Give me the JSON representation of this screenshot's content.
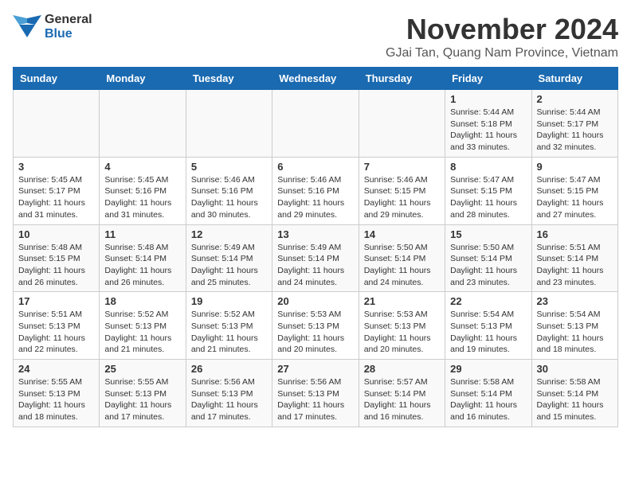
{
  "logo": {
    "general": "General",
    "blue": "Blue"
  },
  "title": "November 2024",
  "location": "GJai Tan, Quang Nam Province, Vietnam",
  "headers": [
    "Sunday",
    "Monday",
    "Tuesday",
    "Wednesday",
    "Thursday",
    "Friday",
    "Saturday"
  ],
  "weeks": [
    [
      {
        "day": "",
        "info": ""
      },
      {
        "day": "",
        "info": ""
      },
      {
        "day": "",
        "info": ""
      },
      {
        "day": "",
        "info": ""
      },
      {
        "day": "",
        "info": ""
      },
      {
        "day": "1",
        "info": "Sunrise: 5:44 AM\nSunset: 5:18 PM\nDaylight: 11 hours\nand 33 minutes."
      },
      {
        "day": "2",
        "info": "Sunrise: 5:44 AM\nSunset: 5:17 PM\nDaylight: 11 hours\nand 32 minutes."
      }
    ],
    [
      {
        "day": "3",
        "info": "Sunrise: 5:45 AM\nSunset: 5:17 PM\nDaylight: 11 hours\nand 31 minutes."
      },
      {
        "day": "4",
        "info": "Sunrise: 5:45 AM\nSunset: 5:16 PM\nDaylight: 11 hours\nand 31 minutes."
      },
      {
        "day": "5",
        "info": "Sunrise: 5:46 AM\nSunset: 5:16 PM\nDaylight: 11 hours\nand 30 minutes."
      },
      {
        "day": "6",
        "info": "Sunrise: 5:46 AM\nSunset: 5:16 PM\nDaylight: 11 hours\nand 29 minutes."
      },
      {
        "day": "7",
        "info": "Sunrise: 5:46 AM\nSunset: 5:15 PM\nDaylight: 11 hours\nand 29 minutes."
      },
      {
        "day": "8",
        "info": "Sunrise: 5:47 AM\nSunset: 5:15 PM\nDaylight: 11 hours\nand 28 minutes."
      },
      {
        "day": "9",
        "info": "Sunrise: 5:47 AM\nSunset: 5:15 PM\nDaylight: 11 hours\nand 27 minutes."
      }
    ],
    [
      {
        "day": "10",
        "info": "Sunrise: 5:48 AM\nSunset: 5:15 PM\nDaylight: 11 hours\nand 26 minutes."
      },
      {
        "day": "11",
        "info": "Sunrise: 5:48 AM\nSunset: 5:14 PM\nDaylight: 11 hours\nand 26 minutes."
      },
      {
        "day": "12",
        "info": "Sunrise: 5:49 AM\nSunset: 5:14 PM\nDaylight: 11 hours\nand 25 minutes."
      },
      {
        "day": "13",
        "info": "Sunrise: 5:49 AM\nSunset: 5:14 PM\nDaylight: 11 hours\nand 24 minutes."
      },
      {
        "day": "14",
        "info": "Sunrise: 5:50 AM\nSunset: 5:14 PM\nDaylight: 11 hours\nand 24 minutes."
      },
      {
        "day": "15",
        "info": "Sunrise: 5:50 AM\nSunset: 5:14 PM\nDaylight: 11 hours\nand 23 minutes."
      },
      {
        "day": "16",
        "info": "Sunrise: 5:51 AM\nSunset: 5:14 PM\nDaylight: 11 hours\nand 23 minutes."
      }
    ],
    [
      {
        "day": "17",
        "info": "Sunrise: 5:51 AM\nSunset: 5:13 PM\nDaylight: 11 hours\nand 22 minutes."
      },
      {
        "day": "18",
        "info": "Sunrise: 5:52 AM\nSunset: 5:13 PM\nDaylight: 11 hours\nand 21 minutes."
      },
      {
        "day": "19",
        "info": "Sunrise: 5:52 AM\nSunset: 5:13 PM\nDaylight: 11 hours\nand 21 minutes."
      },
      {
        "day": "20",
        "info": "Sunrise: 5:53 AM\nSunset: 5:13 PM\nDaylight: 11 hours\nand 20 minutes."
      },
      {
        "day": "21",
        "info": "Sunrise: 5:53 AM\nSunset: 5:13 PM\nDaylight: 11 hours\nand 20 minutes."
      },
      {
        "day": "22",
        "info": "Sunrise: 5:54 AM\nSunset: 5:13 PM\nDaylight: 11 hours\nand 19 minutes."
      },
      {
        "day": "23",
        "info": "Sunrise: 5:54 AM\nSunset: 5:13 PM\nDaylight: 11 hours\nand 18 minutes."
      }
    ],
    [
      {
        "day": "24",
        "info": "Sunrise: 5:55 AM\nSunset: 5:13 PM\nDaylight: 11 hours\nand 18 minutes."
      },
      {
        "day": "25",
        "info": "Sunrise: 5:55 AM\nSunset: 5:13 PM\nDaylight: 11 hours\nand 17 minutes."
      },
      {
        "day": "26",
        "info": "Sunrise: 5:56 AM\nSunset: 5:13 PM\nDaylight: 11 hours\nand 17 minutes."
      },
      {
        "day": "27",
        "info": "Sunrise: 5:56 AM\nSunset: 5:13 PM\nDaylight: 11 hours\nand 17 minutes."
      },
      {
        "day": "28",
        "info": "Sunrise: 5:57 AM\nSunset: 5:14 PM\nDaylight: 11 hours\nand 16 minutes."
      },
      {
        "day": "29",
        "info": "Sunrise: 5:58 AM\nSunset: 5:14 PM\nDaylight: 11 hours\nand 16 minutes."
      },
      {
        "day": "30",
        "info": "Sunrise: 5:58 AM\nSunset: 5:14 PM\nDaylight: 11 hours\nand 15 minutes."
      }
    ]
  ]
}
